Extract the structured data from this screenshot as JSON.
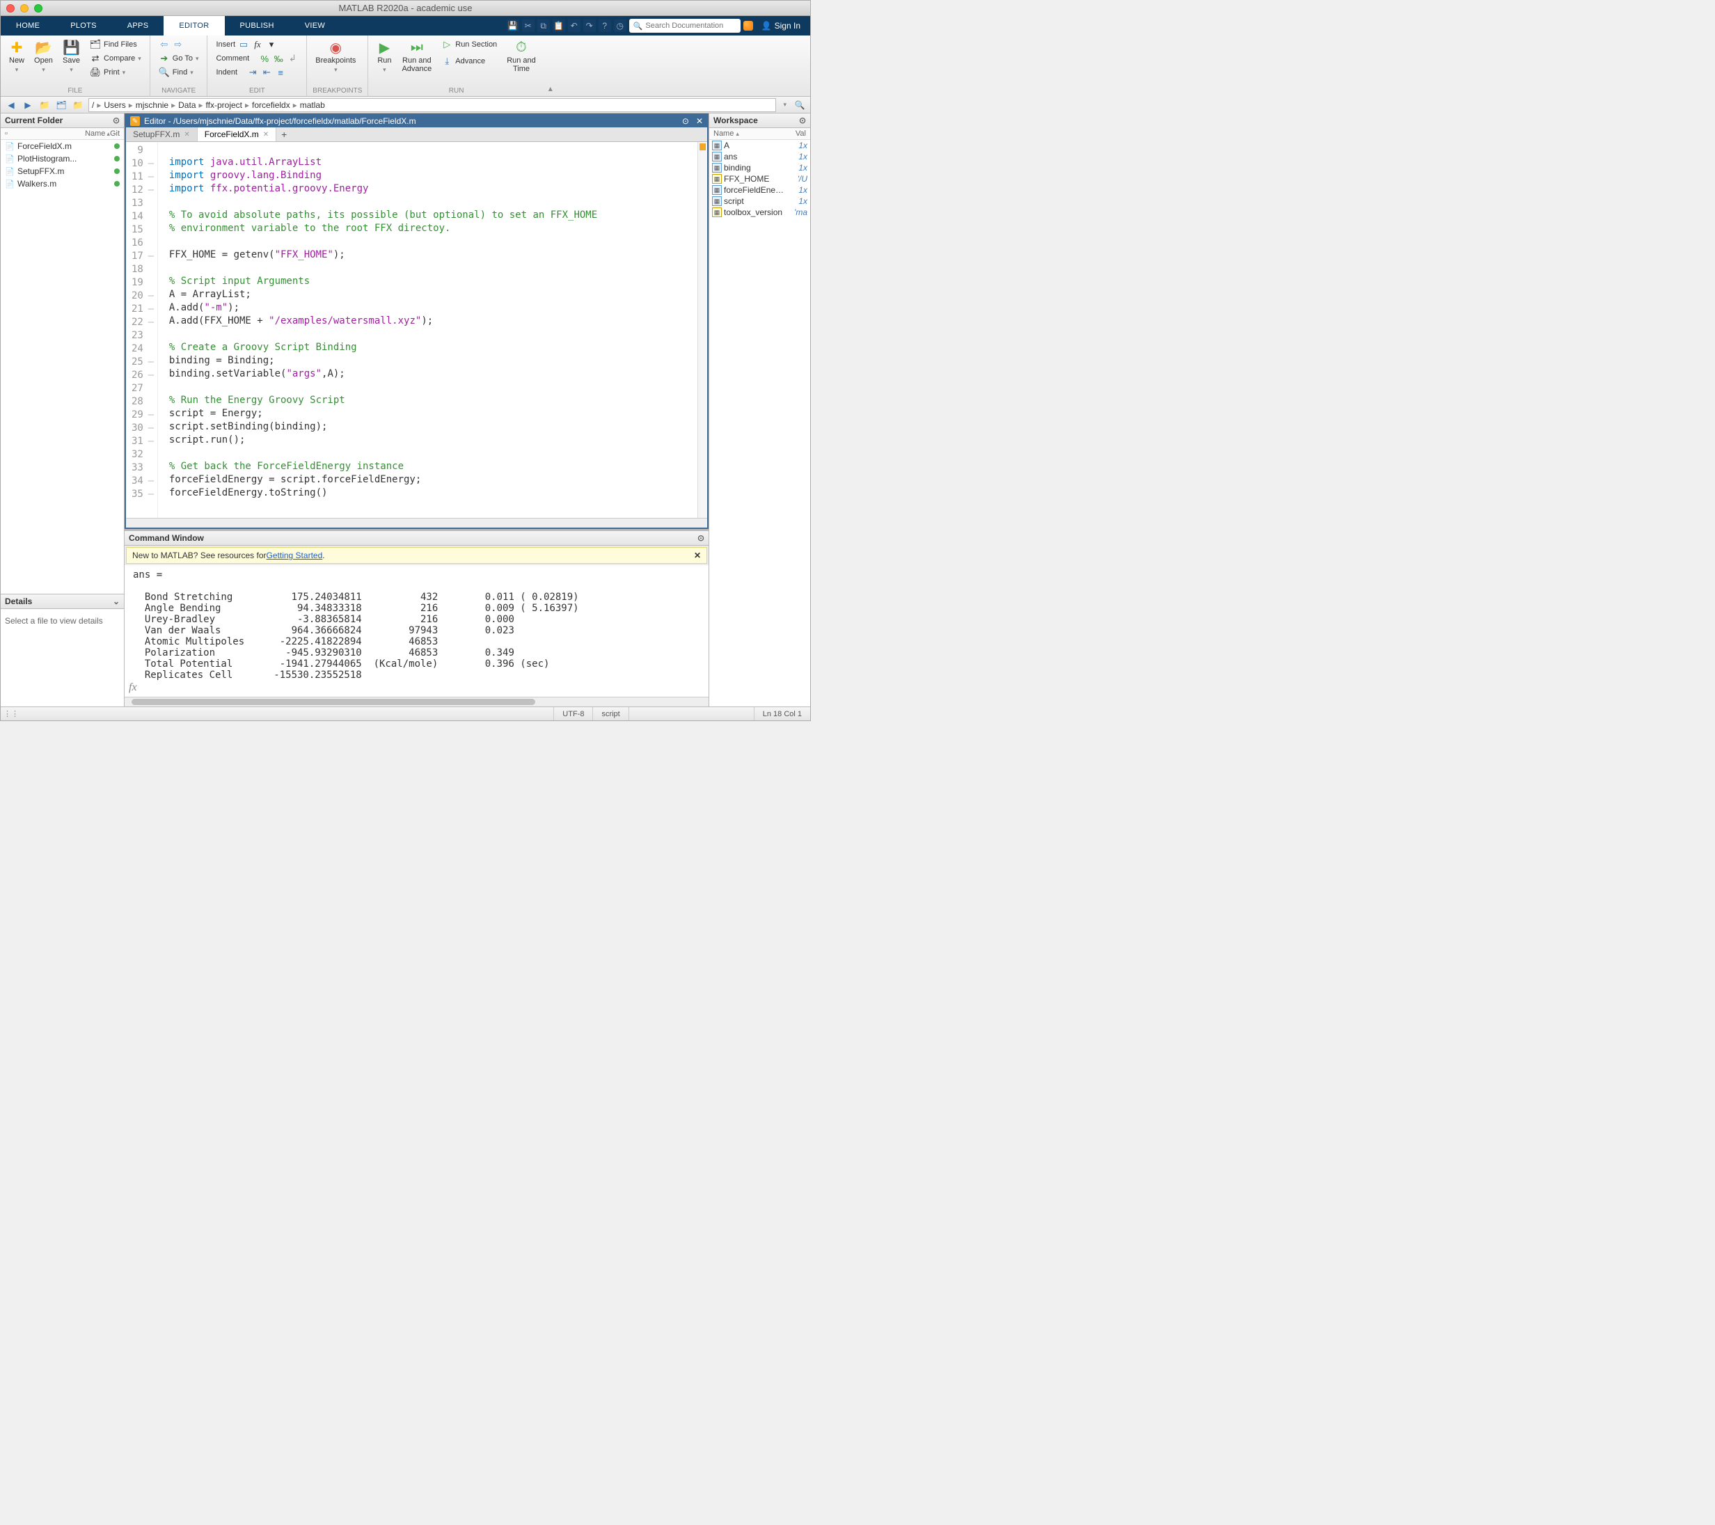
{
  "window": {
    "title": "MATLAB R2020a - academic use"
  },
  "maintabs": [
    "HOME",
    "PLOTS",
    "APPS",
    "EDITOR",
    "PUBLISH",
    "VIEW"
  ],
  "maintab_active": 3,
  "search_placeholder": "Search Documentation",
  "signin": "Sign In",
  "toolstrip": {
    "file": {
      "label": "FILE",
      "new": "New",
      "open": "Open",
      "save": "Save",
      "findfiles": "Find Files",
      "compare": "Compare",
      "print": "Print"
    },
    "navigate": {
      "label": "NAVIGATE",
      "goto": "Go To",
      "find": "Find"
    },
    "edit": {
      "label": "EDIT",
      "insert": "Insert",
      "comment": "Comment",
      "indent": "Indent"
    },
    "breakpoints": {
      "label": "BREAKPOINTS",
      "btn": "Breakpoints"
    },
    "run": {
      "label": "RUN",
      "run": "Run",
      "runadvance": "Run and\nAdvance",
      "runsection": "Run Section",
      "advance": "Advance",
      "runtime": "Run and\nTime"
    }
  },
  "path": [
    "/",
    "Users",
    "mjschnie",
    "Data",
    "ffx-project",
    "forcefieldx",
    "matlab"
  ],
  "currentfolder": {
    "title": "Current Folder",
    "cols": [
      "Name",
      "Git"
    ],
    "files": [
      "ForceFieldX.m",
      "PlotHistogram...",
      "SetupFFX.m",
      "Walkers.m"
    ]
  },
  "details": {
    "title": "Details",
    "msg": "Select a file to view details"
  },
  "editor": {
    "title": "Editor - /Users/mjschnie/Data/ffx-project/forcefieldx/matlab/ForceFieldX.m",
    "tabs": [
      "SetupFFX.m",
      "ForceFieldX.m"
    ],
    "active": 1,
    "lines_start": 9,
    "lines": [
      {
        "n": 9,
        "dash": false,
        "html": ""
      },
      {
        "n": 10,
        "dash": true,
        "html": "<span class='kw'>import</span> <span class='im'>java.util.ArrayList</span>"
      },
      {
        "n": 11,
        "dash": true,
        "html": "<span class='kw'>import</span> <span class='im'>groovy.lang.Binding</span>"
      },
      {
        "n": 12,
        "dash": true,
        "html": "<span class='kw'>import</span> <span class='im'>ffx.potential.groovy.Energy</span>"
      },
      {
        "n": 13,
        "dash": false,
        "html": ""
      },
      {
        "n": 14,
        "dash": false,
        "html": "<span class='cm'>% To avoid absolute paths, its possible (but optional) to set an FFX_HOME</span>"
      },
      {
        "n": 15,
        "dash": false,
        "html": "<span class='cm'>% environment variable to the root FFX directoy.</span>"
      },
      {
        "n": 16,
        "dash": false,
        "html": ""
      },
      {
        "n": 17,
        "dash": true,
        "html": "FFX_HOME = getenv(<span class='st'>\"FFX_HOME\"</span>);"
      },
      {
        "n": 18,
        "dash": false,
        "html": ""
      },
      {
        "n": 19,
        "dash": false,
        "html": "<span class='cm'>% Script input Arguments</span>"
      },
      {
        "n": 20,
        "dash": true,
        "html": "A = ArrayList;"
      },
      {
        "n": 21,
        "dash": true,
        "html": "A.add(<span class='st'>\"-m\"</span>);"
      },
      {
        "n": 22,
        "dash": true,
        "html": "A.add(FFX_HOME + <span class='st'>\"/examples/watersmall.xyz\"</span>);"
      },
      {
        "n": 23,
        "dash": false,
        "html": ""
      },
      {
        "n": 24,
        "dash": false,
        "html": "<span class='cm'>% Create a Groovy Script Binding</span>"
      },
      {
        "n": 25,
        "dash": true,
        "html": "binding = Binding;"
      },
      {
        "n": 26,
        "dash": true,
        "html": "binding.setVariable(<span class='st'>\"args\"</span>,A);"
      },
      {
        "n": 27,
        "dash": false,
        "html": ""
      },
      {
        "n": 28,
        "dash": false,
        "html": "<span class='cm'>% Run the Energy Groovy Script</span>"
      },
      {
        "n": 29,
        "dash": true,
        "html": "script = Energy;"
      },
      {
        "n": 30,
        "dash": true,
        "html": "script.setBinding(binding);"
      },
      {
        "n": 31,
        "dash": true,
        "html": "script.run();"
      },
      {
        "n": 32,
        "dash": false,
        "html": ""
      },
      {
        "n": 33,
        "dash": false,
        "html": "<span class='cm'>% Get back the ForceFieldEnergy instance</span>"
      },
      {
        "n": 34,
        "dash": true,
        "html": "forceFieldEnergy = script.forceFieldEnergy;"
      },
      {
        "n": 35,
        "dash": true,
        "html": "forceFieldEnergy.toString()"
      }
    ]
  },
  "cmdwin": {
    "title": "Command Window",
    "newto_prefix": "New to MATLAB? See resources for ",
    "newto_link": "Getting Started",
    "output": "ans =\n\n  Bond Stretching          175.24034811          432        0.011 ( 0.02819)\n  Angle Bending             94.34833318          216        0.009 ( 5.16397)\n  Urey-Bradley              -3.88365814          216        0.000\n  Van der Waals            964.36666824        97943        0.023\n  Atomic Multipoles      -2225.41822894        46853\n  Polarization            -945.93290310        46853        0.349\n  Total Potential        -1941.27944065  (Kcal/mole)        0.396 (sec)\n  Replicates Cell       -15530.23552518"
  },
  "workspace": {
    "title": "Workspace",
    "cols": [
      "Name",
      "Val"
    ],
    "vars": [
      {
        "icon": "blue",
        "name": "A",
        "val": "1x"
      },
      {
        "icon": "blue",
        "name": "ans",
        "val": "1x"
      },
      {
        "icon": "blue",
        "name": "binding",
        "val": "1x"
      },
      {
        "icon": "txt",
        "name": "FFX_HOME",
        "val": "'/U"
      },
      {
        "icon": "blue",
        "name": "forceFieldEnergy",
        "val": "1x"
      },
      {
        "icon": "blue",
        "name": "script",
        "val": "1x"
      },
      {
        "icon": "txt",
        "name": "toolbox_version",
        "val": "'ma"
      }
    ]
  },
  "status": {
    "encoding": "UTF-8",
    "type": "script",
    "pos": "Ln  18   Col  1"
  }
}
